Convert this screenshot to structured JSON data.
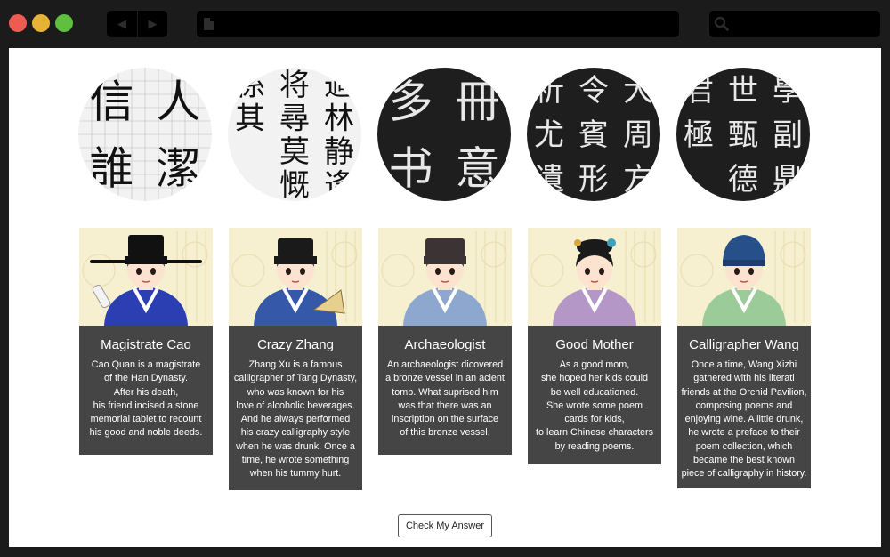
{
  "browser": {
    "back_glyph": "◀",
    "forward_glyph": "▶",
    "icons": [
      "page-icon",
      "search-icon"
    ]
  },
  "circles": [
    {
      "name": "calligraphy-grid-sample",
      "glyphs": [
        "人",
        "潔",
        "信",
        "誰"
      ],
      "tone": "light"
    },
    {
      "name": "running-script-sample",
      "glyphs": [
        "適",
        "林",
        "静",
        "逢",
        "将",
        "尋",
        "莫",
        "慨",
        "係",
        "其"
      ],
      "tone": "light"
    },
    {
      "name": "cursive-script-rubbing",
      "glyphs": [
        "冊",
        "意",
        "多",
        "书"
      ],
      "tone": "dark"
    },
    {
      "name": "seal-script-rubbing",
      "glyphs": [
        "大",
        "周",
        "方",
        "令",
        "賓",
        "形",
        "祈",
        "尤",
        "遺"
      ],
      "tone": "dark"
    },
    {
      "name": "regular-script-rubbing",
      "glyphs": [
        "學",
        "副",
        "鼎",
        "世",
        "甄",
        "德",
        "君",
        "極"
      ],
      "tone": "dark"
    }
  ],
  "cards": [
    {
      "name": "Magistrate Cao",
      "description": "Cao Quan is a magistrate\nof the Han Dynasty.\nAfter his death,\nhis friend incised a stone\nmemorial tablet to recount\nhis good and noble deeds.",
      "robe_color": "#2b3fb3",
      "hat_color": "#111111"
    },
    {
      "name": "Crazy Zhang",
      "description": "Zhang Xu is a famous\ncalligrapher of Tang Dynasty,\nwho was known for his\nlove of alcoholic beverages.\nAnd he always performed\nhis crazy calligraphy style\nwhen he was drunk. Once a\ntime, he wrote something\nwhen his tummy hurt.",
      "robe_color": "#3558a8",
      "hat_color": "#1a1a1a"
    },
    {
      "name": "Archaeologist",
      "description": "An archaeologist dicovered\na bronze vessel in an acient\ntomb. What suprised him\nwas that there was an\ninscription on the surface\nof this bronze vessel.",
      "robe_color": "#8ea7cf",
      "hat_color": "#3c3434"
    },
    {
      "name": "Good Mother",
      "description": "As a good mom,\nshe hoped her kids could\nbe well educationed.\nShe wrote some poem\ncards for kids,\nto learn Chinese characters\nby reading poems.",
      "robe_color": "#b497c6",
      "hat_color": "#1a1a1a"
    },
    {
      "name": "Calligrapher Wang",
      "description": "Once a time, Wang Xizhi\ngathered with his literati\nfriends at the Orchid Pavilion,\ncomposing poems and\nenjoying wine. A little drunk,\nhe wrote a preface to their\npoem collection, which\nbecame the best known\npiece of calligraphy in history.",
      "robe_color": "#9ccb9a",
      "hat_color": "#27508a"
    }
  ],
  "check_button_label": "Check My Answer"
}
